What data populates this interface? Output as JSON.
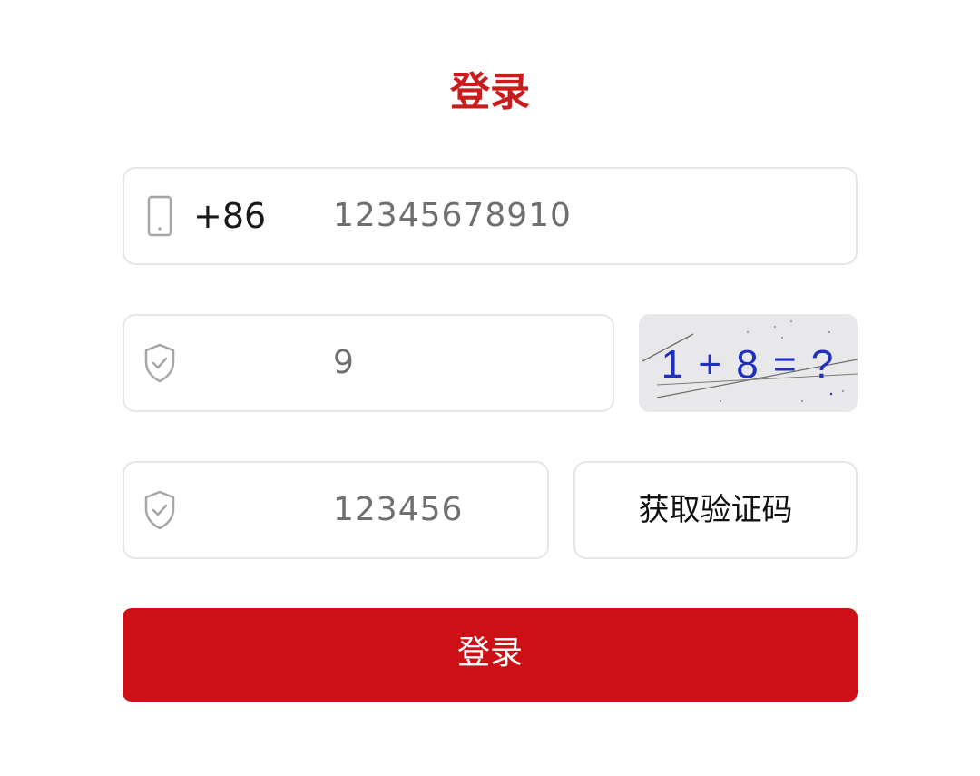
{
  "page": {
    "title": "登录"
  },
  "phone": {
    "icon": "phone-icon",
    "country_code": "+86",
    "value": "12345678910"
  },
  "captcha": {
    "icon": "shield-check-icon",
    "value": "9",
    "image_text": "1 + 8 = ?"
  },
  "sms_code": {
    "icon": "shield-check-icon",
    "value": "123456",
    "button_label": "获取验证码"
  },
  "login_button": {
    "label": "登录"
  },
  "colors": {
    "accent": "#cd1015",
    "title": "#c91c1c",
    "border": "#e6e6e6",
    "captcha_text": "#1f2fbf"
  }
}
